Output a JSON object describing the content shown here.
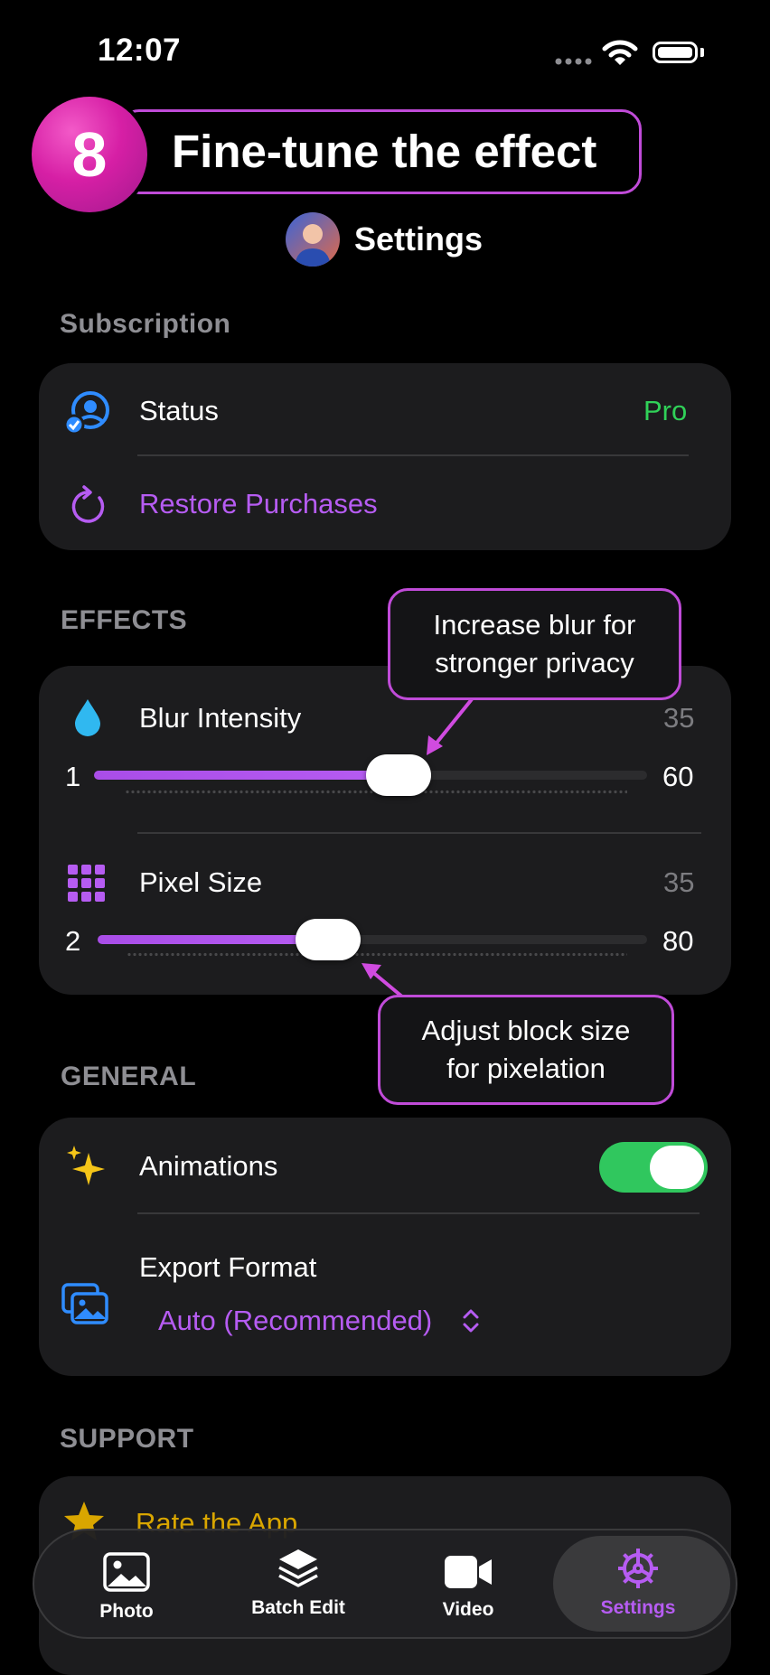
{
  "status_bar": {
    "time": "12:07"
  },
  "step": {
    "number": "8",
    "title": "Fine-tune the effect"
  },
  "header": {
    "title": "Settings"
  },
  "subscription": {
    "section_label": "Subscription",
    "status_label": "Status",
    "status_value": "Pro",
    "restore_label": "Restore Purchases"
  },
  "effects": {
    "section_label": "EFFECTS",
    "blur": {
      "label": "Blur Intensity",
      "value": "35",
      "min": "1",
      "max": "60",
      "fraction": 0.55
    },
    "pixel": {
      "label": "Pixel Size",
      "value": "35",
      "min": "2",
      "max": "80",
      "fraction": 0.42
    }
  },
  "callouts": {
    "blur": {
      "line1": "Increase blur for",
      "line2": "stronger privacy"
    },
    "pixel": {
      "line1": "Adjust block size",
      "line2": "for pixelation"
    }
  },
  "general": {
    "section_label": "GENERAL",
    "animations_label": "Animations",
    "animations_on": true,
    "export_label": "Export Format",
    "export_value": "Auto (Recommended)"
  },
  "support": {
    "section_label": "SUPPORT",
    "rate_label": "Rate the App"
  },
  "tabbar": {
    "tabs": [
      {
        "label": "Photo",
        "icon": "photo-icon",
        "selected": false
      },
      {
        "label": "Batch Edit",
        "icon": "layers-icon",
        "selected": false
      },
      {
        "label": "Video",
        "icon": "video-camera-icon",
        "selected": false
      },
      {
        "label": "Settings",
        "icon": "gear-icon",
        "selected": true
      }
    ]
  },
  "colors": {
    "accent_purple": "#b65cf2",
    "pro_green": "#30d158",
    "toggle_green": "#30c75e",
    "callout_border": "#c04bd8",
    "badge_magenta": "#d61fa5"
  }
}
